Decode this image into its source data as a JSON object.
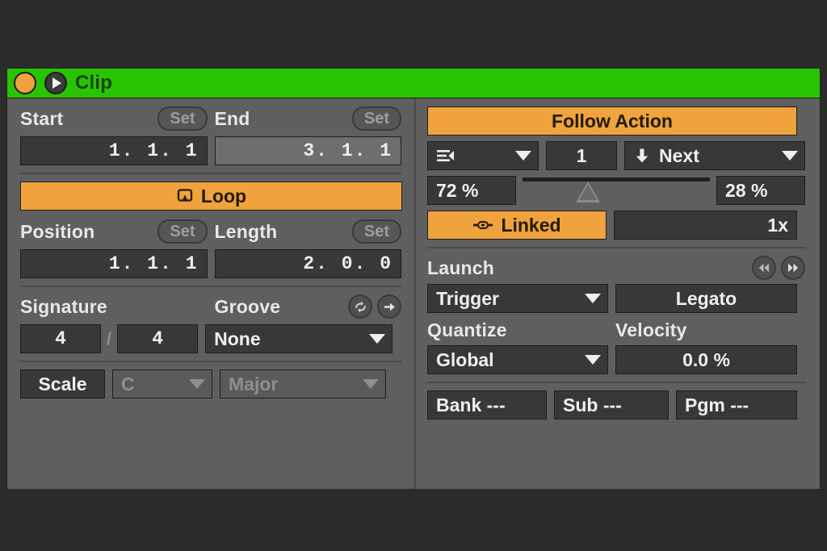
{
  "window": {
    "background_color": "#2b2b2b",
    "panel_background": "#5f5f5f",
    "accent_orange": "#f0a33c",
    "header_green": "#28c404"
  },
  "header": {
    "title": "Clip",
    "activator_icon": "orange-dot-icon",
    "play_icon": "play-icon"
  },
  "left": {
    "start_label": "Start",
    "start_set_label": "Set",
    "start_value": "1. 1. 1",
    "end_label": "End",
    "end_set_label": "Set",
    "end_value": "3. 1. 1",
    "loop_label": "Loop",
    "loop_icon": "loop-icon",
    "position_label": "Position",
    "position_set_label": "Set",
    "position_value": "1. 1. 1",
    "length_label": "Length",
    "length_set_label": "Set",
    "length_value": "2. 0. 0",
    "signature_label": "Signature",
    "groove_label": "Groove",
    "groove_hotswap_icon": "hotswap-icon",
    "groove_commit_icon": "arrow-right-icon",
    "signature_numerator": "4",
    "signature_separator": "/",
    "signature_denominator": "4",
    "groove_value": "None",
    "scale_label": "Scale",
    "scale_root": "C",
    "scale_mode": "Major"
  },
  "right": {
    "follow_action_label": "Follow Action",
    "follow_mode_icon": "clip-list-icon",
    "follow_bars_value": "1",
    "follow_action_icon": "arrow-down-icon",
    "follow_action_value": "Next",
    "chance_a": "72 %",
    "chance_b": "28 %",
    "chance_slider_position_pct": 35,
    "linked_label": "Linked",
    "linked_icon": "link-icon",
    "multiplier_value": "1x",
    "launch_label": "Launch",
    "prev_icon": "prev-icon",
    "next_icon": "next-icon",
    "prev_label": "«",
    "next_label": "»",
    "launch_mode_value": "Trigger",
    "legato_label": "Legato",
    "quantize_label": "Quantize",
    "velocity_label": "Velocity",
    "quantize_value": "Global",
    "velocity_value": "0.0 %",
    "bank_label": "Bank ---",
    "sub_label": "Sub ---",
    "pgm_label": "Pgm ---"
  }
}
